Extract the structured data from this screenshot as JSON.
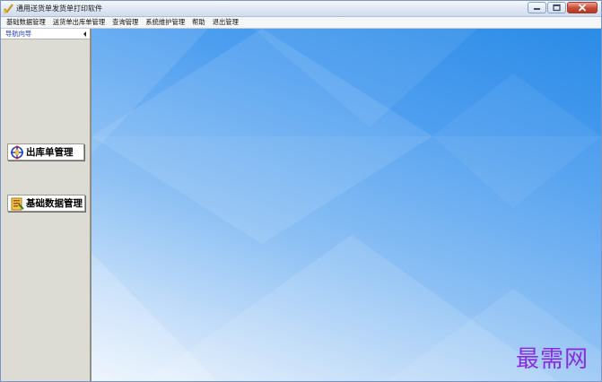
{
  "window": {
    "title": "通用送货单发货单打印软件",
    "app_icon": "app-icon",
    "controls": {
      "minimize": "minimize-icon",
      "maximize": "maximize-icon",
      "close": "close-icon"
    }
  },
  "menubar": {
    "items": [
      {
        "label": "基础数据管理"
      },
      {
        "label": "送货单出库单管理"
      },
      {
        "label": "查询管理"
      },
      {
        "label": "系统维护管理"
      },
      {
        "label": "帮助"
      },
      {
        "label": "退出管理"
      }
    ]
  },
  "sidebar": {
    "header": "导航向导",
    "collapse_icon": "chevron-left-icon",
    "buttons": [
      {
        "label": "出库单管理",
        "icon": "outbound-order-icon"
      },
      {
        "label": "基础数据管理",
        "icon": "base-data-icon"
      }
    ]
  },
  "main": {
    "watermark": "最需网",
    "colors": {
      "bg_top": "#2a8be6",
      "bg_bottom": "#eaf4fd",
      "watermark": "#8a2be2"
    }
  }
}
